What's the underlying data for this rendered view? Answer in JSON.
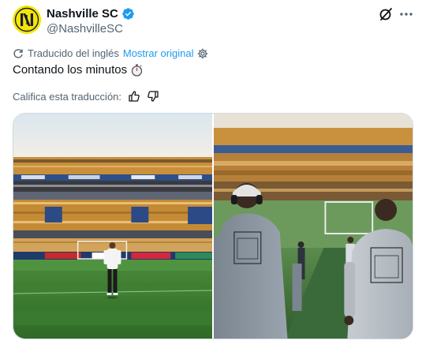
{
  "post": {
    "author": {
      "display_name": "Nashville SC",
      "handle": "@NashvilleSC",
      "verified": true,
      "avatar_text": "NSC",
      "avatar_colors": {
        "background": "#f3e600",
        "foreground": "#1b1b3a"
      }
    },
    "translation": {
      "notice": "Traducido del inglés",
      "show_original_label": "Mostrar original"
    },
    "text": "Contando los minutos",
    "text_emoji": "stopwatch-icon",
    "rate": {
      "prompt": "Califica esta traducción:",
      "like_icon": "thumbs-up-icon",
      "dislike_icon": "thumbs-down-icon"
    },
    "header_icons": [
      "grok-icon",
      "more-icon"
    ],
    "media": [
      {
        "name": "stadium-field-photo",
        "alt": ""
      },
      {
        "name": "players-tunnel-photo",
        "alt": ""
      }
    ]
  },
  "colors": {
    "text_primary": "#0f1419",
    "text_secondary": "#536471",
    "link_blue": "#1d9bf0",
    "verified_blue": "#1d9bf0",
    "border": "#cfd9de"
  }
}
